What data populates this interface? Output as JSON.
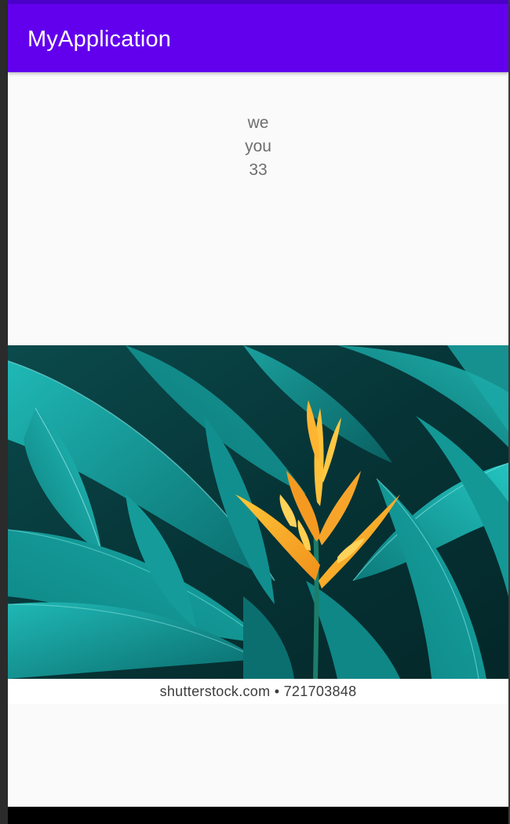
{
  "app": {
    "title": "MyApplication",
    "accent_color": "#6200ee",
    "status_color": "#4a00c8"
  },
  "content": {
    "lines": [
      "we",
      "you",
      "33"
    ],
    "text_color": "#6e6e6e"
  },
  "image": {
    "subject": "heliconia-flower-on-teal-leaves",
    "watermark": "shutterstock.com • 721703848"
  },
  "system": {
    "nav_bar_color": "#000000"
  }
}
